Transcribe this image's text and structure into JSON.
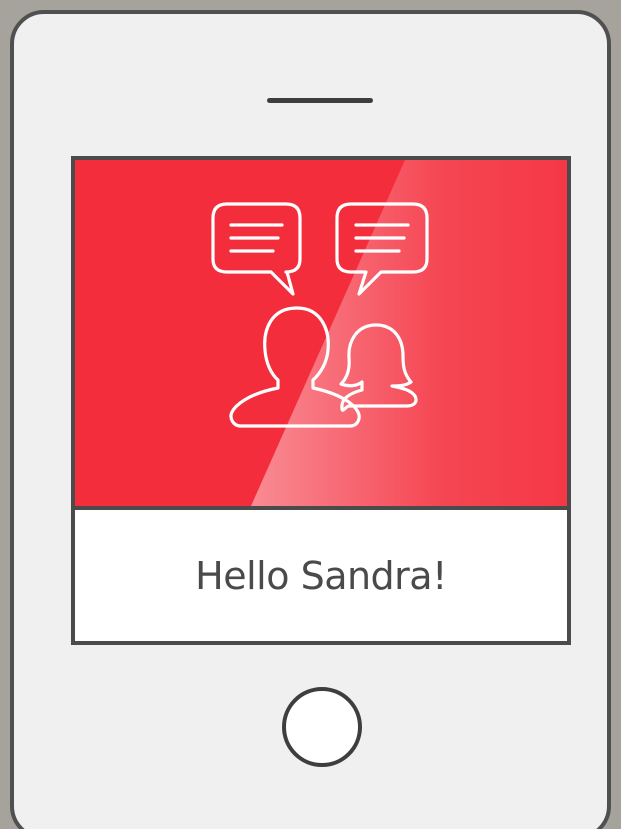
{
  "screen": {
    "greeting": "Hello Sandra!"
  },
  "icons": {
    "chat_left": "chat-bubble-icon",
    "chat_right": "chat-bubble-icon",
    "person_male": "person-icon",
    "person_female": "person-icon"
  },
  "colors": {
    "banner_red": "#f42d3c",
    "device_body": "#f1f0f1",
    "device_outline": "#505050",
    "background": "#a5a39c"
  }
}
